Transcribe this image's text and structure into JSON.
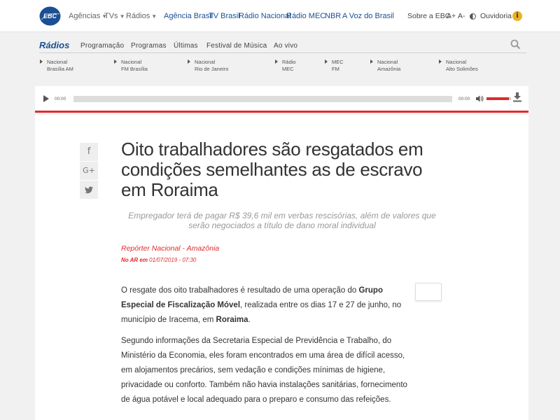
{
  "brand": {
    "logo_text": "EBC"
  },
  "topbar": {
    "dropdowns": [
      "Agências",
      "TVs",
      "Rádios"
    ],
    "links": [
      "Agência Brasil",
      "TV Brasil",
      "Rádio Nacional",
      "Rádio MEC",
      "NBR",
      "A Voz do Brasil"
    ],
    "right": {
      "about": "Sobre a EBC",
      "font_up": "A+",
      "font_down": "A-",
      "ombudsman": "Ouvidoria",
      "info_glyph": "i"
    }
  },
  "radios_nav": {
    "title": "Rádios",
    "links": [
      "Programação",
      "Programas",
      "Últimas",
      "Festival de Música",
      "Ao vivo"
    ],
    "stations": [
      {
        "line1": "Nacional",
        "line2": "Brasília AM"
      },
      {
        "line1": "Nacional",
        "line2": "FM Brasília"
      },
      {
        "line1": "Nacional",
        "line2": "Rio de Janeiro"
      },
      {
        "line1": "Rádio",
        "line2": "MEC"
      },
      {
        "line1": "MEC",
        "line2": "FM"
      },
      {
        "line1": "Nacional",
        "line2": "Amazônia"
      },
      {
        "line1": "Nacional",
        "line2": "Alto Solimões"
      }
    ]
  },
  "player": {
    "time_elapsed": "00:00",
    "time_total": "00:00",
    "volume": 0.9
  },
  "article": {
    "share": {
      "facebook_glyph": "f",
      "gplus_glyph": "G+",
      "twitter_glyph": "🐦"
    },
    "title": "Oito trabalhadores são resgatados em condições semelhantes as de escravo em Roraima",
    "subtitle": "Empregador terá de pagar R$ 39,6 mil em verbas rescisórias, além de valores que serão negociados a título de dano moral individual",
    "reporter": "Repórter Nacional - Amazônia",
    "air_label": "No AR em",
    "air_date": "01/07/2019 - 07:30",
    "p1": {
      "a": "O resgate dos oito trabalhadores é resultado de uma operação do ",
      "b": "Grupo Especial de Fiscalização Móvel",
      "c": ", realizada entre os dias 17 e 27 de junho, no município de Iracema, em ",
      "d": "Roraima",
      "e": "."
    },
    "p2": "Segundo informações da Secretaria Especial de Previdência e Trabalho, do Ministério da Economia, eles foram encontrados em uma área de difícil acesso, em alojamentos precários, sem vedação e condições mínimas de higiene, privacidade ou conforto. Também não havia instalações sanitárias, fornecimento de água potável e local adequado para o preparo e consumo das refeições."
  },
  "colors": {
    "brand_blue": "#1b4f93",
    "accent_red": "#e02b2b",
    "info_yellow": "#e8b224"
  }
}
